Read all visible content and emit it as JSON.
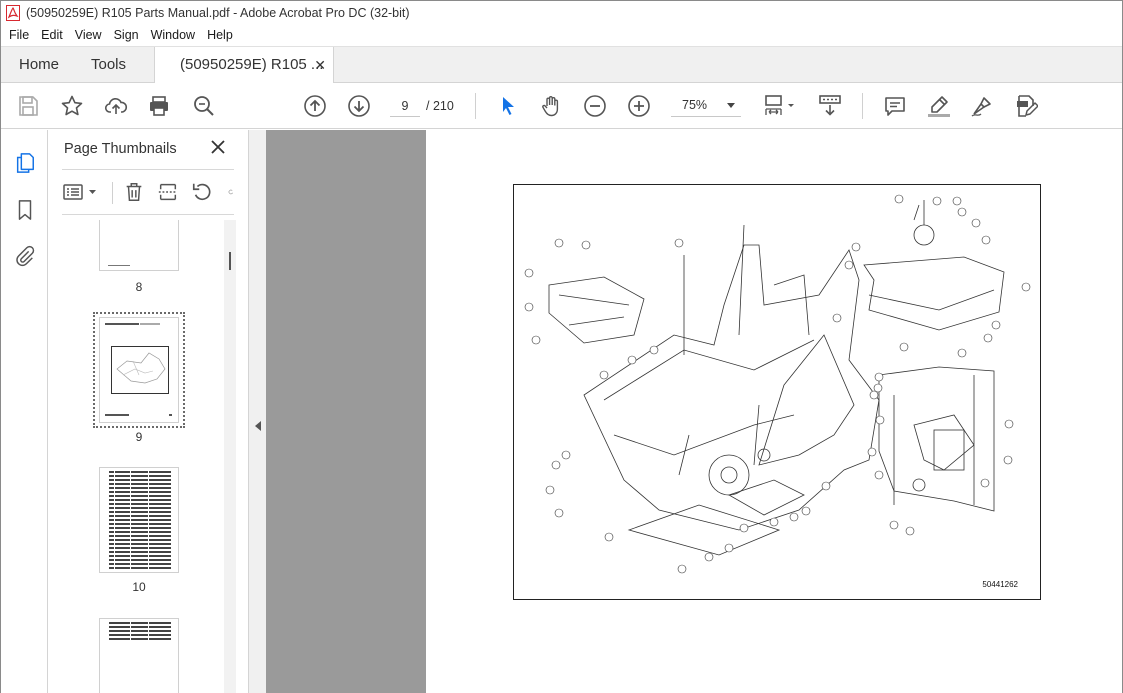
{
  "window": {
    "title": "(50950259E) R105 Parts Manual.pdf - Adobe Acrobat Pro DC (32-bit)"
  },
  "menu": [
    "File",
    "Edit",
    "View",
    "Sign",
    "Window",
    "Help"
  ],
  "tabs": {
    "home": "Home",
    "tools": "Tools",
    "document": "(50950259E) R105 ...",
    "close_glyph": "✕"
  },
  "toolbar": {
    "current_page": "9",
    "total_pages": "/ 210",
    "zoom": "75%",
    "icons": [
      "save-icon",
      "star-icon",
      "upload-icon",
      "print-icon",
      "search-icon",
      "arrow-up-icon",
      "arrow-down-icon",
      "select-arrow-icon",
      "hand-icon",
      "zoom-out-icon",
      "zoom-in-icon",
      "page-fit-icon",
      "scroll-mode-icon",
      "comment-icon",
      "highlight-icon",
      "sign-icon",
      "edit-pdf-icon"
    ]
  },
  "sidebar": {
    "title": "Page Thumbnails",
    "close_glyph": "✕",
    "rail_icons": [
      "pages-icon",
      "bookmark-icon",
      "attachment-icon"
    ],
    "thumbnails": [
      {
        "label": "8"
      },
      {
        "label": "9",
        "selected": true
      },
      {
        "label": "10"
      },
      {
        "label": ""
      }
    ]
  },
  "document": {
    "drawing_number": "50441262"
  },
  "colors": {
    "accent": "#1473e6",
    "acrobat_red": "#d7282f",
    "gray_margin": "#9a9a9a"
  }
}
